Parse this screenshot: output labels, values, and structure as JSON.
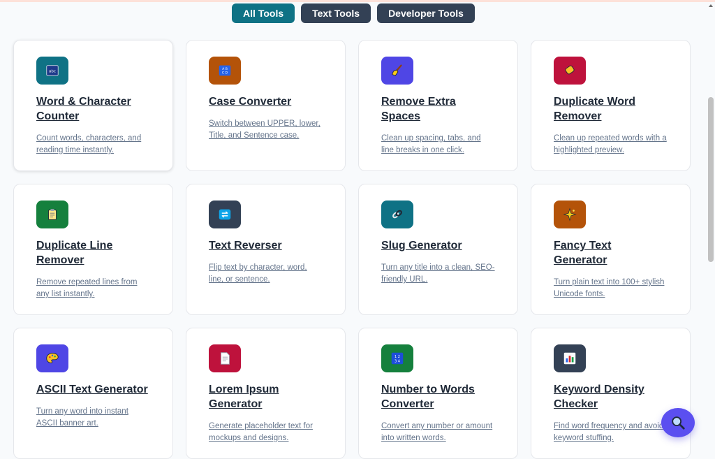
{
  "filters": {
    "all": "All Tools",
    "text": "Text Tools",
    "developer": "Developer Tools"
  },
  "tools": [
    {
      "title": "Word & Character Counter",
      "description": "Count words, characters, and reading time instantly.",
      "icon": "abc-icon",
      "color": "#0f7285"
    },
    {
      "title": "Case Converter",
      "description": "Switch between UPPER, lower, Title, and Sentence case.",
      "icon": "abcd-icon",
      "color": "#b45309"
    },
    {
      "title": "Remove Extra Spaces",
      "description": "Clean up spacing, tabs, and line breaks in one click.",
      "icon": "broom-icon",
      "color": "#4f46e5"
    },
    {
      "title": "Duplicate Word Remover",
      "description": "Clean up repeated words with a highlighted preview.",
      "icon": "eraser-icon",
      "color": "#be123c"
    },
    {
      "title": "Duplicate Line Remover",
      "description": "Remove repeated lines from any list instantly.",
      "icon": "clipboard-icon",
      "color": "#15803d"
    },
    {
      "title": "Text Reverser",
      "description": "Flip text by character, word, line, or sentence.",
      "icon": "reverse-icon",
      "color": "#334155"
    },
    {
      "title": "Slug Generator",
      "description": "Turn any title into a clean, SEO-friendly URL.",
      "icon": "link-icon",
      "color": "#0f7285"
    },
    {
      "title": "Fancy Text Generator",
      "description": "Turn plain text into 100+ stylish Unicode fonts.",
      "icon": "sparkles-icon",
      "color": "#b45309"
    },
    {
      "title": "ASCII Text Generator",
      "description": "Turn any word into instant ASCII banner art.",
      "icon": "palette-icon",
      "color": "#4f46e5"
    },
    {
      "title": "Lorem Ipsum Generator",
      "description": "Generate placeholder text for mockups and designs.",
      "icon": "document-icon",
      "color": "#be123c"
    },
    {
      "title": "Number to Words Converter",
      "description": "Convert any number or amount into written words.",
      "icon": "numbers-icon",
      "color": "#15803d"
    },
    {
      "title": "Keyword Density Checker",
      "description": "Find word frequency and avoid keyword stuffing.",
      "icon": "bar-chart-icon",
      "color": "#334155"
    }
  ],
  "fab": {
    "icon": "search-icon",
    "color": "#5b4ff0"
  }
}
